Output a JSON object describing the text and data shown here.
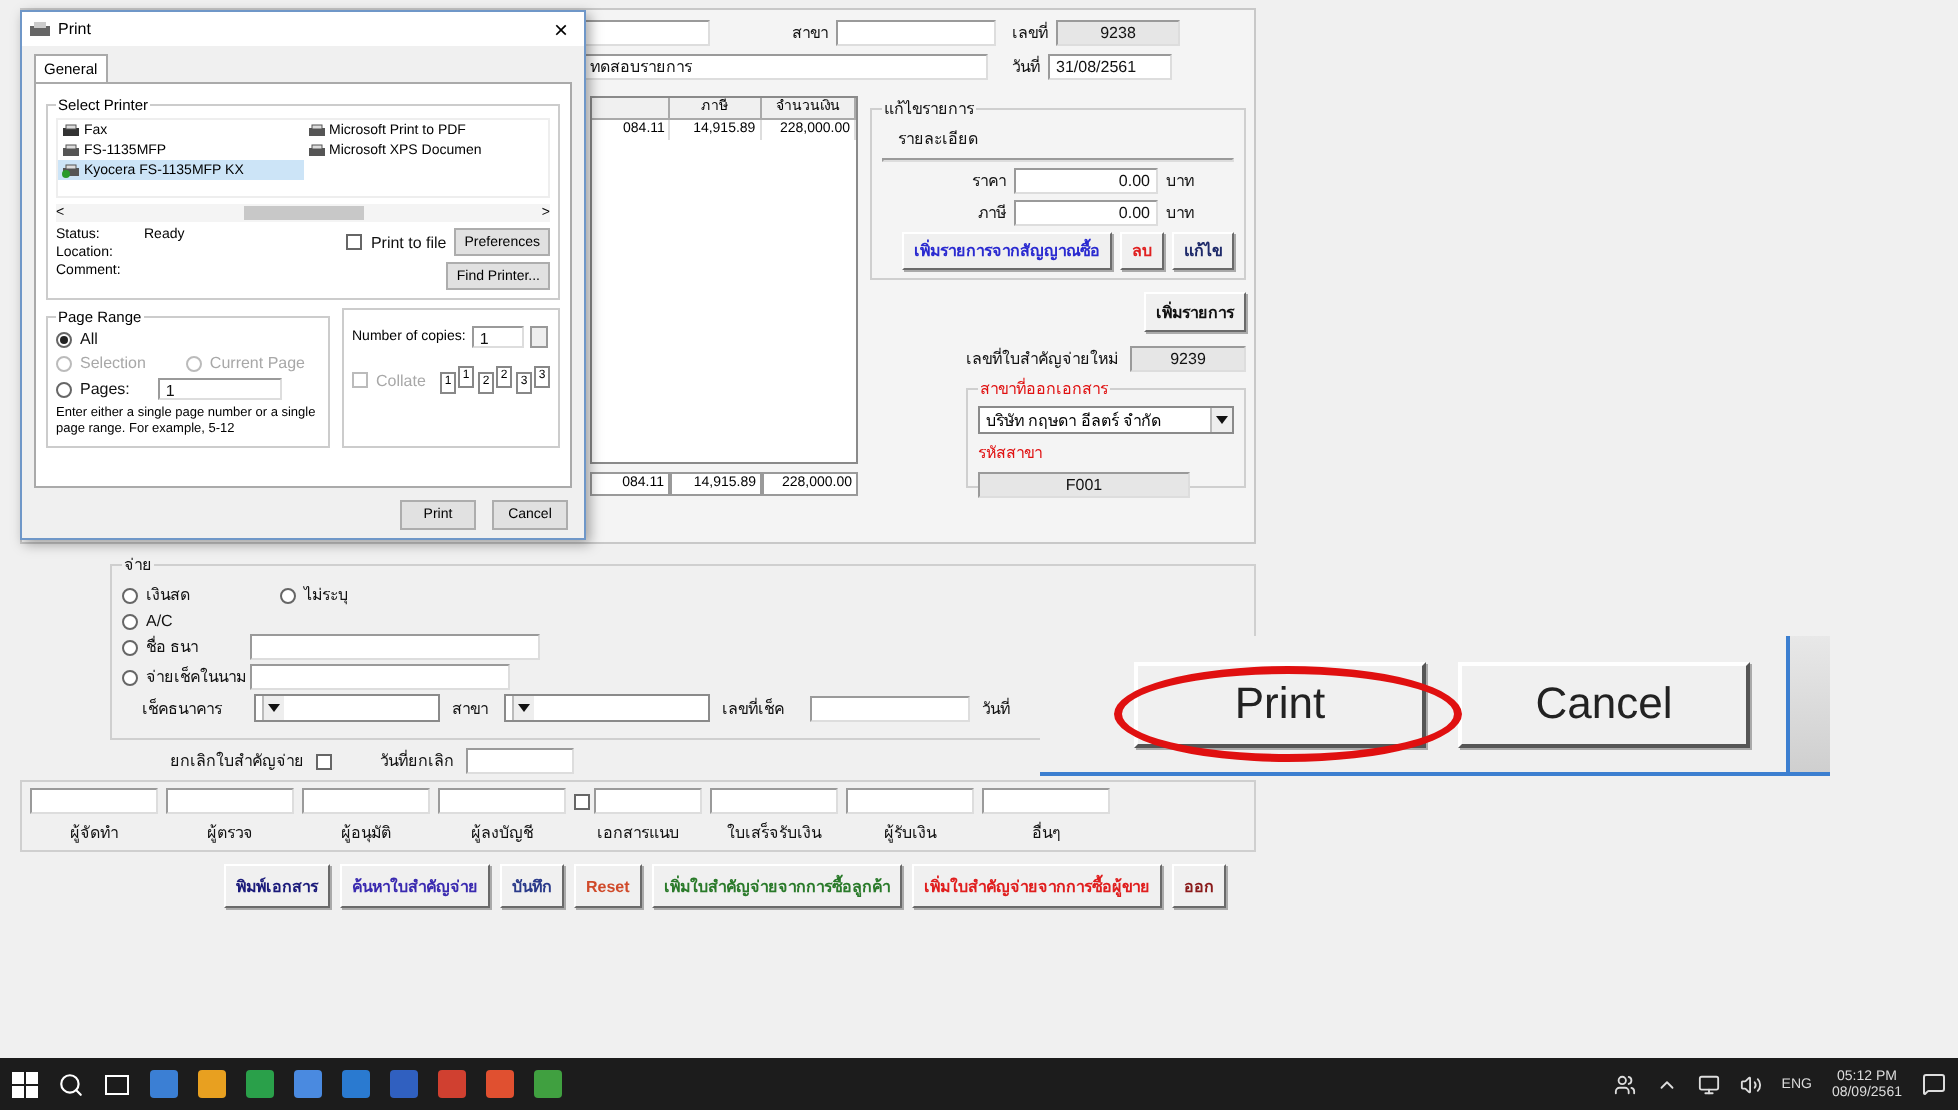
{
  "print_dialog": {
    "title": "Print",
    "close": "×",
    "tabs": [
      {
        "label": "General",
        "selected": true
      }
    ],
    "select_printer": {
      "legend": "Select Printer",
      "printers": [
        {
          "name": "Fax",
          "kind": "fax",
          "selected": false
        },
        {
          "name": "FS-1135MFP",
          "kind": "printer",
          "selected": false
        },
        {
          "name": "Kyocera FS-1135MFP KX",
          "kind": "default",
          "selected": true
        },
        {
          "name": "Microsoft Print to PDF",
          "kind": "printer",
          "selected": false
        },
        {
          "name": "Microsoft XPS Documen",
          "kind": "printer",
          "selected": false
        }
      ],
      "scroll_left": "<",
      "scroll_right": ">",
      "info": [
        {
          "label": "Status:",
          "value": "Ready"
        },
        {
          "label": "Location:"
        },
        {
          "label": "Comment:"
        }
      ],
      "print_to_file": {
        "label": "Print to file",
        "checked": false
      },
      "preferences": "Preferences",
      "find_printer": "Find Printer..."
    },
    "page_range": {
      "legend": "Page Range",
      "options": [
        {
          "label": "All",
          "selected": true,
          "disabled": false
        },
        {
          "label": "Selection",
          "selected": false,
          "disabled": true
        },
        {
          "label": "Current Page",
          "selected": false,
          "disabled": true
        },
        {
          "label": "Pages:",
          "selected": false,
          "disabled": false
        }
      ],
      "pages_value": "1",
      "hint": "Enter either a single page number or a single page range.  For example, 5-12"
    },
    "copies": {
      "label": "Number of copies:",
      "value": "1",
      "collate": {
        "label": "Collate",
        "checked": false,
        "disabled": true
      },
      "collate_pages": [
        "1",
        "1",
        "2",
        "2",
        "3",
        "3"
      ]
    },
    "buttons": [
      "Print",
      "Cancel"
    ]
  },
  "header": {
    "branch_label": "สาขา",
    "number_label": "เลขที่",
    "number": "9238",
    "note": "ทดสอบรายการ",
    "date_label": "วันที่",
    "date": "31/08/2561"
  },
  "items_table": {
    "columns": [
      {},
      {
        "label": "ภาษี"
      },
      {
        "label": "จำนวนเงิน"
      }
    ],
    "rows": [
      [
        "084.11",
        "14,915.89",
        "228,000.00"
      ]
    ],
    "totals": [
      "084.11",
      "14,915.89",
      "228,000.00"
    ]
  },
  "edit_group": {
    "legend": "แก้ไขรายการ",
    "detail_label": "รายละเอียด",
    "fields": [
      {
        "label": "ราคา",
        "value": "0.00",
        "unit": "บาท"
      },
      {
        "label": "ภาษี",
        "value": "0.00",
        "unit": "บาท"
      }
    ],
    "buttons": [
      {
        "label": "เพิ่มรายการจากสัญญาณซื้อ",
        "color": "#2a2ad0"
      },
      {
        "label": "ลบ",
        "color": "#e02020"
      },
      {
        "label": "แก้ไข",
        "color": "#1e2a6a"
      }
    ]
  },
  "add_item": "เพิ่มรายการ",
  "new_voucher": {
    "label": "เลขที่ใบสำคัญจ่ายใหม่",
    "value": "9239"
  },
  "company_group": {
    "legend": "สาขาที่ออกเอกสาร",
    "company": "บริษัท กฤษดา อีลตร์ จำกัด",
    "code_label": "รหัสสาขา",
    "code": "F001"
  },
  "payment": {
    "legend": "จ่าย",
    "options": [
      {
        "label": "เงินสด",
        "selected": false
      },
      {
        "label": "ไม่ระบุ",
        "selected": false
      },
      {
        "label": "A/C",
        "selected": false
      },
      {
        "label": "ชื่อ ธนา",
        "selected": false
      },
      {
        "label": "จ่ายเช็คในนาม",
        "selected": false
      }
    ],
    "bank_label": "เช็คธนาคาร",
    "branch_label": "สาขา",
    "cheque_no_label": "เลขที่เช็ค",
    "date_label": "วันที่"
  },
  "cancel": {
    "label": "ยกเลิกใบสำคัญจ่าย",
    "checked": false,
    "date_label": "วันที่ยกเลิก"
  },
  "signatures": [
    {
      "label": "ผู้จัดทำ",
      "kind": "field"
    },
    {
      "label": "ผู้ตรวจ",
      "kind": "field"
    },
    {
      "label": "ผู้อนุมัติ",
      "kind": "field"
    },
    {
      "label": "ผู้ลงบัญชี",
      "kind": "field"
    },
    {
      "label": "เอกสารแนบ",
      "kind": "check",
      "checked": false
    },
    {
      "label": "ใบเสร็จรับเงิน",
      "kind": "field"
    },
    {
      "label": "ผู้รับเงิน",
      "kind": "field"
    },
    {
      "label": "อื่นๆ",
      "kind": "field"
    }
  ],
  "actions": [
    {
      "label": "พิมพ์เอกสาร",
      "color": "#1a1a7a"
    },
    {
      "label": "ค้นหาใบสำคัญจ่าย",
      "color": "#3a2ab0"
    },
    {
      "label": "บันทึก",
      "color": "#2a3a8a"
    },
    {
      "label": "Reset",
      "color": "#d04a2a"
    },
    {
      "label": "เพิ่มใบสำคัญจ่ายจากการซื้อลูกค้า",
      "color": "#2a7a2a"
    },
    {
      "label": "เพิ่มใบสำคัญจ่ายจากการซื้อผู้ขาย",
      "color": "#e01e1e"
    },
    {
      "label": "ออก",
      "color": "#8a1a1a"
    }
  ],
  "zoom_inset": {
    "buttons": [
      {
        "label": "Print",
        "circled": true
      },
      {
        "label": "Cancel",
        "circled": false
      }
    ]
  },
  "taskbar": {
    "language": "ENG",
    "time": "05:12 PM",
    "date": "08/09/2561"
  }
}
